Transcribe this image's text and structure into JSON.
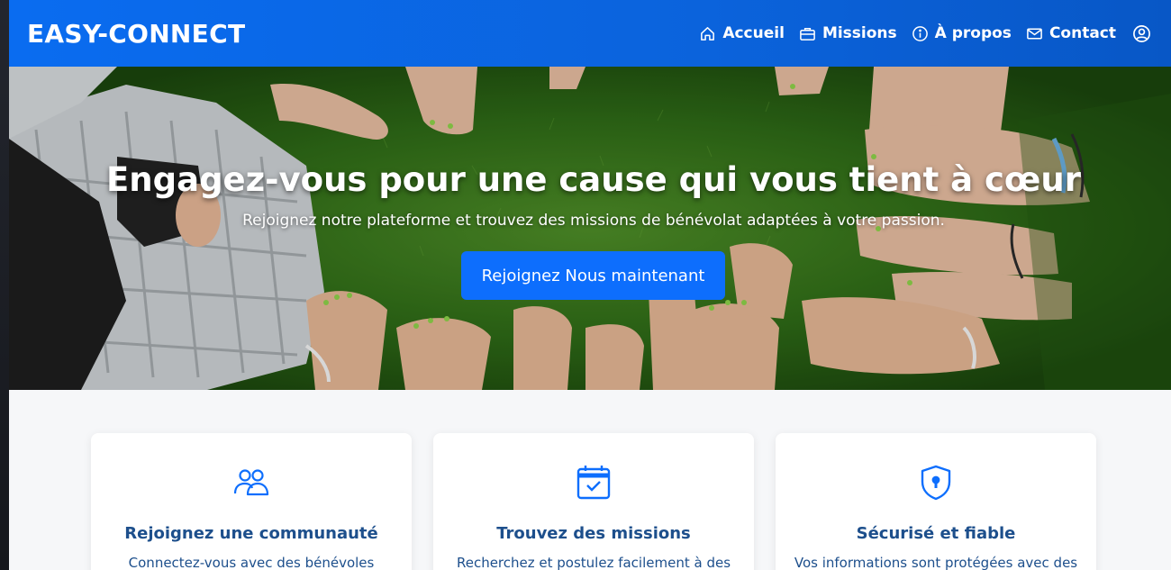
{
  "navbar": {
    "brand": "EASY-CONNECT",
    "links": [
      {
        "label": "Accueil",
        "icon": "home-icon"
      },
      {
        "label": "Missions",
        "icon": "briefcase-icon"
      },
      {
        "label": "À propos",
        "icon": "info-icon"
      },
      {
        "label": "Contact",
        "icon": "envelope-icon"
      }
    ],
    "user_icon": "user-circle-icon"
  },
  "hero": {
    "title": "Engagez-vous pour une cause qui vous tient à cœur",
    "subtitle": "Rejoignez notre plateforme et trouvez des missions de bénévolat adaptées à votre passion.",
    "cta_label": "Rejoignez Nous maintenant"
  },
  "features": [
    {
      "icon": "people-icon",
      "title": "Rejoignez une communauté",
      "text": "Connectez-vous avec des bénévoles"
    },
    {
      "icon": "calendar-check-icon",
      "title": "Trouvez des missions",
      "text": "Recherchez et postulez facilement à des"
    },
    {
      "icon": "shield-lock-icon",
      "title": "Sécurisé et fiable",
      "text": "Vos informations sont protégées avec des"
    }
  ],
  "colors": {
    "primary": "#0d6efd",
    "navbar": "#0b63dc",
    "feature_text": "#1d4f8c",
    "section_bg": "#f6f7f9"
  }
}
